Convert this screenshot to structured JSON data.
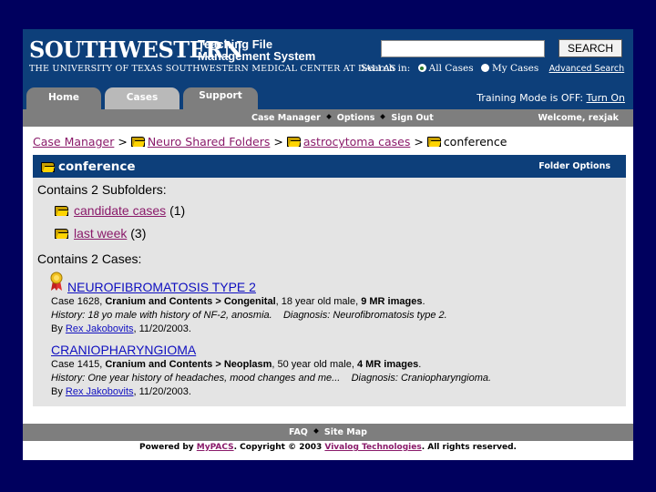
{
  "header": {
    "brand": "SOUTHWESTERN",
    "system_line1": "Teaching File",
    "system_line2": "Management System",
    "university": "THE UNIVERSITY OF TEXAS SOUTHWESTERN MEDICAL CENTER AT DALLAS",
    "search_value": "",
    "search_button": "SEARCH",
    "search_in_label": "Search in:",
    "option_all": "All Cases",
    "option_my": "My Cases",
    "option_selected": "All Cases",
    "advanced_search": "Advanced Search"
  },
  "tabs": [
    {
      "label": "Home",
      "active": false
    },
    {
      "label": "Cases",
      "active": true
    },
    {
      "label": "Support",
      "active": false
    }
  ],
  "training": {
    "text": "Training Mode is OFF:",
    "link": "Turn On"
  },
  "subnav": {
    "items": [
      "Case Manager",
      "Options",
      "Sign Out"
    ],
    "welcome": "Welcome, rexjak"
  },
  "breadcrumb": {
    "items": [
      "Case Manager",
      "Neuro Shared Folders",
      "astrocytoma cases"
    ],
    "separator": ">",
    "current": "conference"
  },
  "folder": {
    "title": "conference",
    "options_label": "Folder Options",
    "subfolders_heading": "Contains 2 Subfolders:",
    "subfolders": [
      {
        "name": "candidate cases",
        "count": "(1)"
      },
      {
        "name": "last week",
        "count": "(3)"
      }
    ],
    "cases_heading": "Contains 2 Cases:"
  },
  "cases": [
    {
      "title": "NEUROFIBROMATOSIS TYPE 2",
      "case_no": "Case 1628,",
      "category": "Cranium and Contents > Congenital",
      "patient": ", 18 year old male,",
      "images": "9 MR images",
      "images_suffix": ".",
      "history": "History: 18 yo male with history of NF-2, anosmia.",
      "diagnosis": "Diagnosis: Neurofibromatosis type 2.",
      "by": "By",
      "author": "Rex Jakobovits",
      "date": ", 11/20/2003.",
      "awarded": true
    },
    {
      "title": "CRANIOPHARYNGIOMA",
      "case_no": "Case 1415,",
      "category": "Cranium and Contents > Neoplasm",
      "patient": ", 50 year old male,",
      "images": "4 MR images",
      "images_suffix": ".",
      "history": "History: One year history of headaches, mood changes and me...",
      "diagnosis": "Diagnosis: Craniopharyngioma.",
      "by": "By",
      "author": "Rex Jakobovits",
      "date": ", 11/20/2003.",
      "awarded": false
    }
  ],
  "footer": {
    "links": [
      "FAQ",
      "Site Map"
    ],
    "powered_by": "Powered by",
    "powered_link": "MyPACS",
    "copyright": ".   Copyright © 2003",
    "company": "Vivalog Technologies",
    "rights": ". All rights reserved."
  },
  "colors": {
    "background": "#00005e",
    "header": "#0d3f7a",
    "nav_gray": "#7e7e7e",
    "content_gray": "#e4e4e4",
    "visited_link": "#8a1a6a",
    "link": "#1010c0"
  }
}
